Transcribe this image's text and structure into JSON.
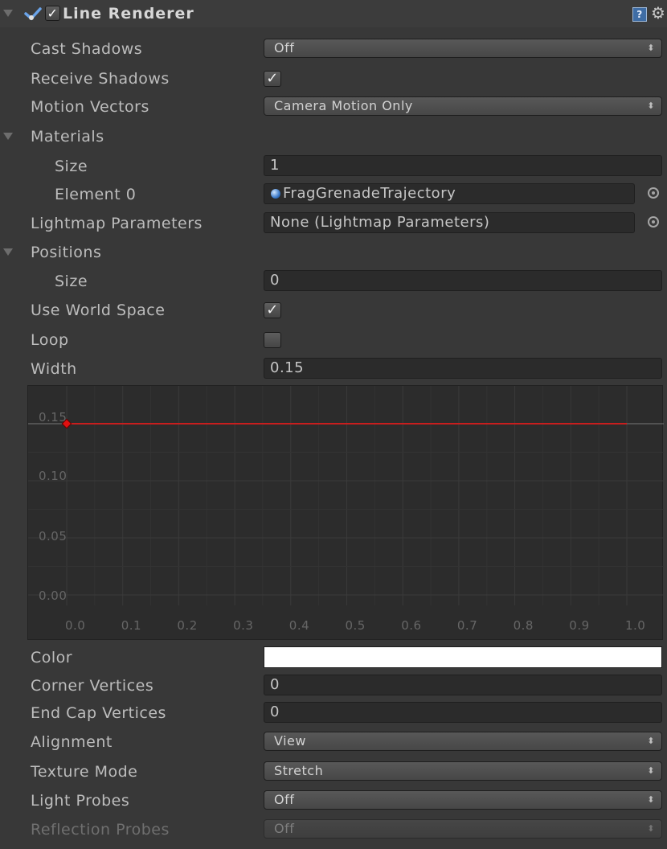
{
  "header": {
    "title": "Line Renderer",
    "help_icon_glyph": "?",
    "gear_icon_glyph": "⚙"
  },
  "rows": {
    "cast_shadows": {
      "label": "Cast Shadows",
      "value": "Off"
    },
    "receive_shadows": {
      "label": "Receive Shadows",
      "checked": true
    },
    "motion_vectors": {
      "label": "Motion Vectors",
      "value": "Camera Motion Only"
    },
    "materials": {
      "label": "Materials"
    },
    "materials_size": {
      "label": "Size",
      "value": "1"
    },
    "element0": {
      "label": "Element 0",
      "value": "FragGrenadeTrajectory"
    },
    "lightmap": {
      "label": "Lightmap Parameters",
      "value": "None (Lightmap Parameters)"
    },
    "positions": {
      "label": "Positions"
    },
    "positions_size": {
      "label": "Size",
      "value": "0"
    },
    "use_world_space": {
      "label": "Use World Space",
      "checked": true
    },
    "loop": {
      "label": "Loop",
      "checked": false
    },
    "width": {
      "label": "Width",
      "value": "0.15"
    },
    "color": {
      "label": "Color",
      "swatch": "#ffffff"
    },
    "corner_vertices": {
      "label": "Corner Vertices",
      "value": "0"
    },
    "end_cap_vertices": {
      "label": "End Cap Vertices",
      "value": "0"
    },
    "alignment": {
      "label": "Alignment",
      "value": "View"
    },
    "texture_mode": {
      "label": "Texture Mode",
      "value": "Stretch"
    },
    "light_probes": {
      "label": "Light Probes",
      "value": "Off"
    },
    "reflection_probes": {
      "label": "Reflection Probes",
      "value": "Off"
    }
  },
  "glyphs": {
    "check": "✓",
    "dropdown_arrows": "⬍"
  },
  "chart_data": {
    "type": "line",
    "x_ticks": [
      "0.0",
      "0.1",
      "0.2",
      "0.3",
      "0.4",
      "0.5",
      "0.6",
      "0.7",
      "0.8",
      "0.9",
      "1.0"
    ],
    "y_ticks": [
      "0.00",
      "0.05",
      "0.10",
      "0.15"
    ],
    "xlim": [
      0,
      1
    ],
    "ylim": [
      0,
      0.15
    ],
    "series": [
      {
        "x": [
          0.0,
          1.0
        ],
        "y": [
          0.15,
          0.15
        ],
        "color": "#c81e1e"
      }
    ],
    "keyframes": [
      {
        "x": 0.0,
        "y": 0.15
      }
    ]
  }
}
